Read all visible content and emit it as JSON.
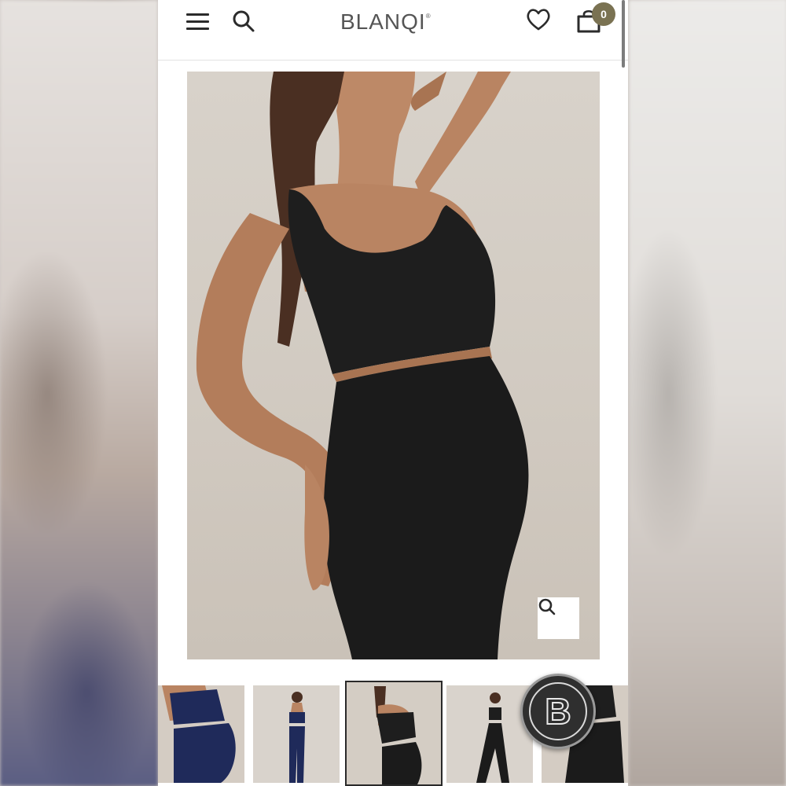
{
  "header": {
    "logo_text": "BLANQI",
    "logo_mark": "®",
    "cart_count": "0",
    "icons": [
      "menu-icon",
      "search-icon",
      "heart-icon",
      "cart-icon"
    ]
  },
  "hero": {
    "zoom_icon": "search-icon",
    "colors": {
      "backdrop": "#d4cdc4",
      "garment": "#1c1c1c",
      "skin": "#b98462"
    }
  },
  "thumbnails": {
    "selected_index": 2,
    "items": [
      {
        "garment_color": "#1f2a5a"
      },
      {
        "garment_color": "#1f2a5a"
      },
      {
        "garment_color": "#1c1c1c"
      },
      {
        "garment_color": "#1c1c1c"
      },
      {
        "garment_color": "#1c1c1c"
      }
    ]
  },
  "brand_button": {
    "letter": "B"
  },
  "colors": {
    "cart_badge": "#7a7252",
    "icon": "#2b2b2b"
  }
}
